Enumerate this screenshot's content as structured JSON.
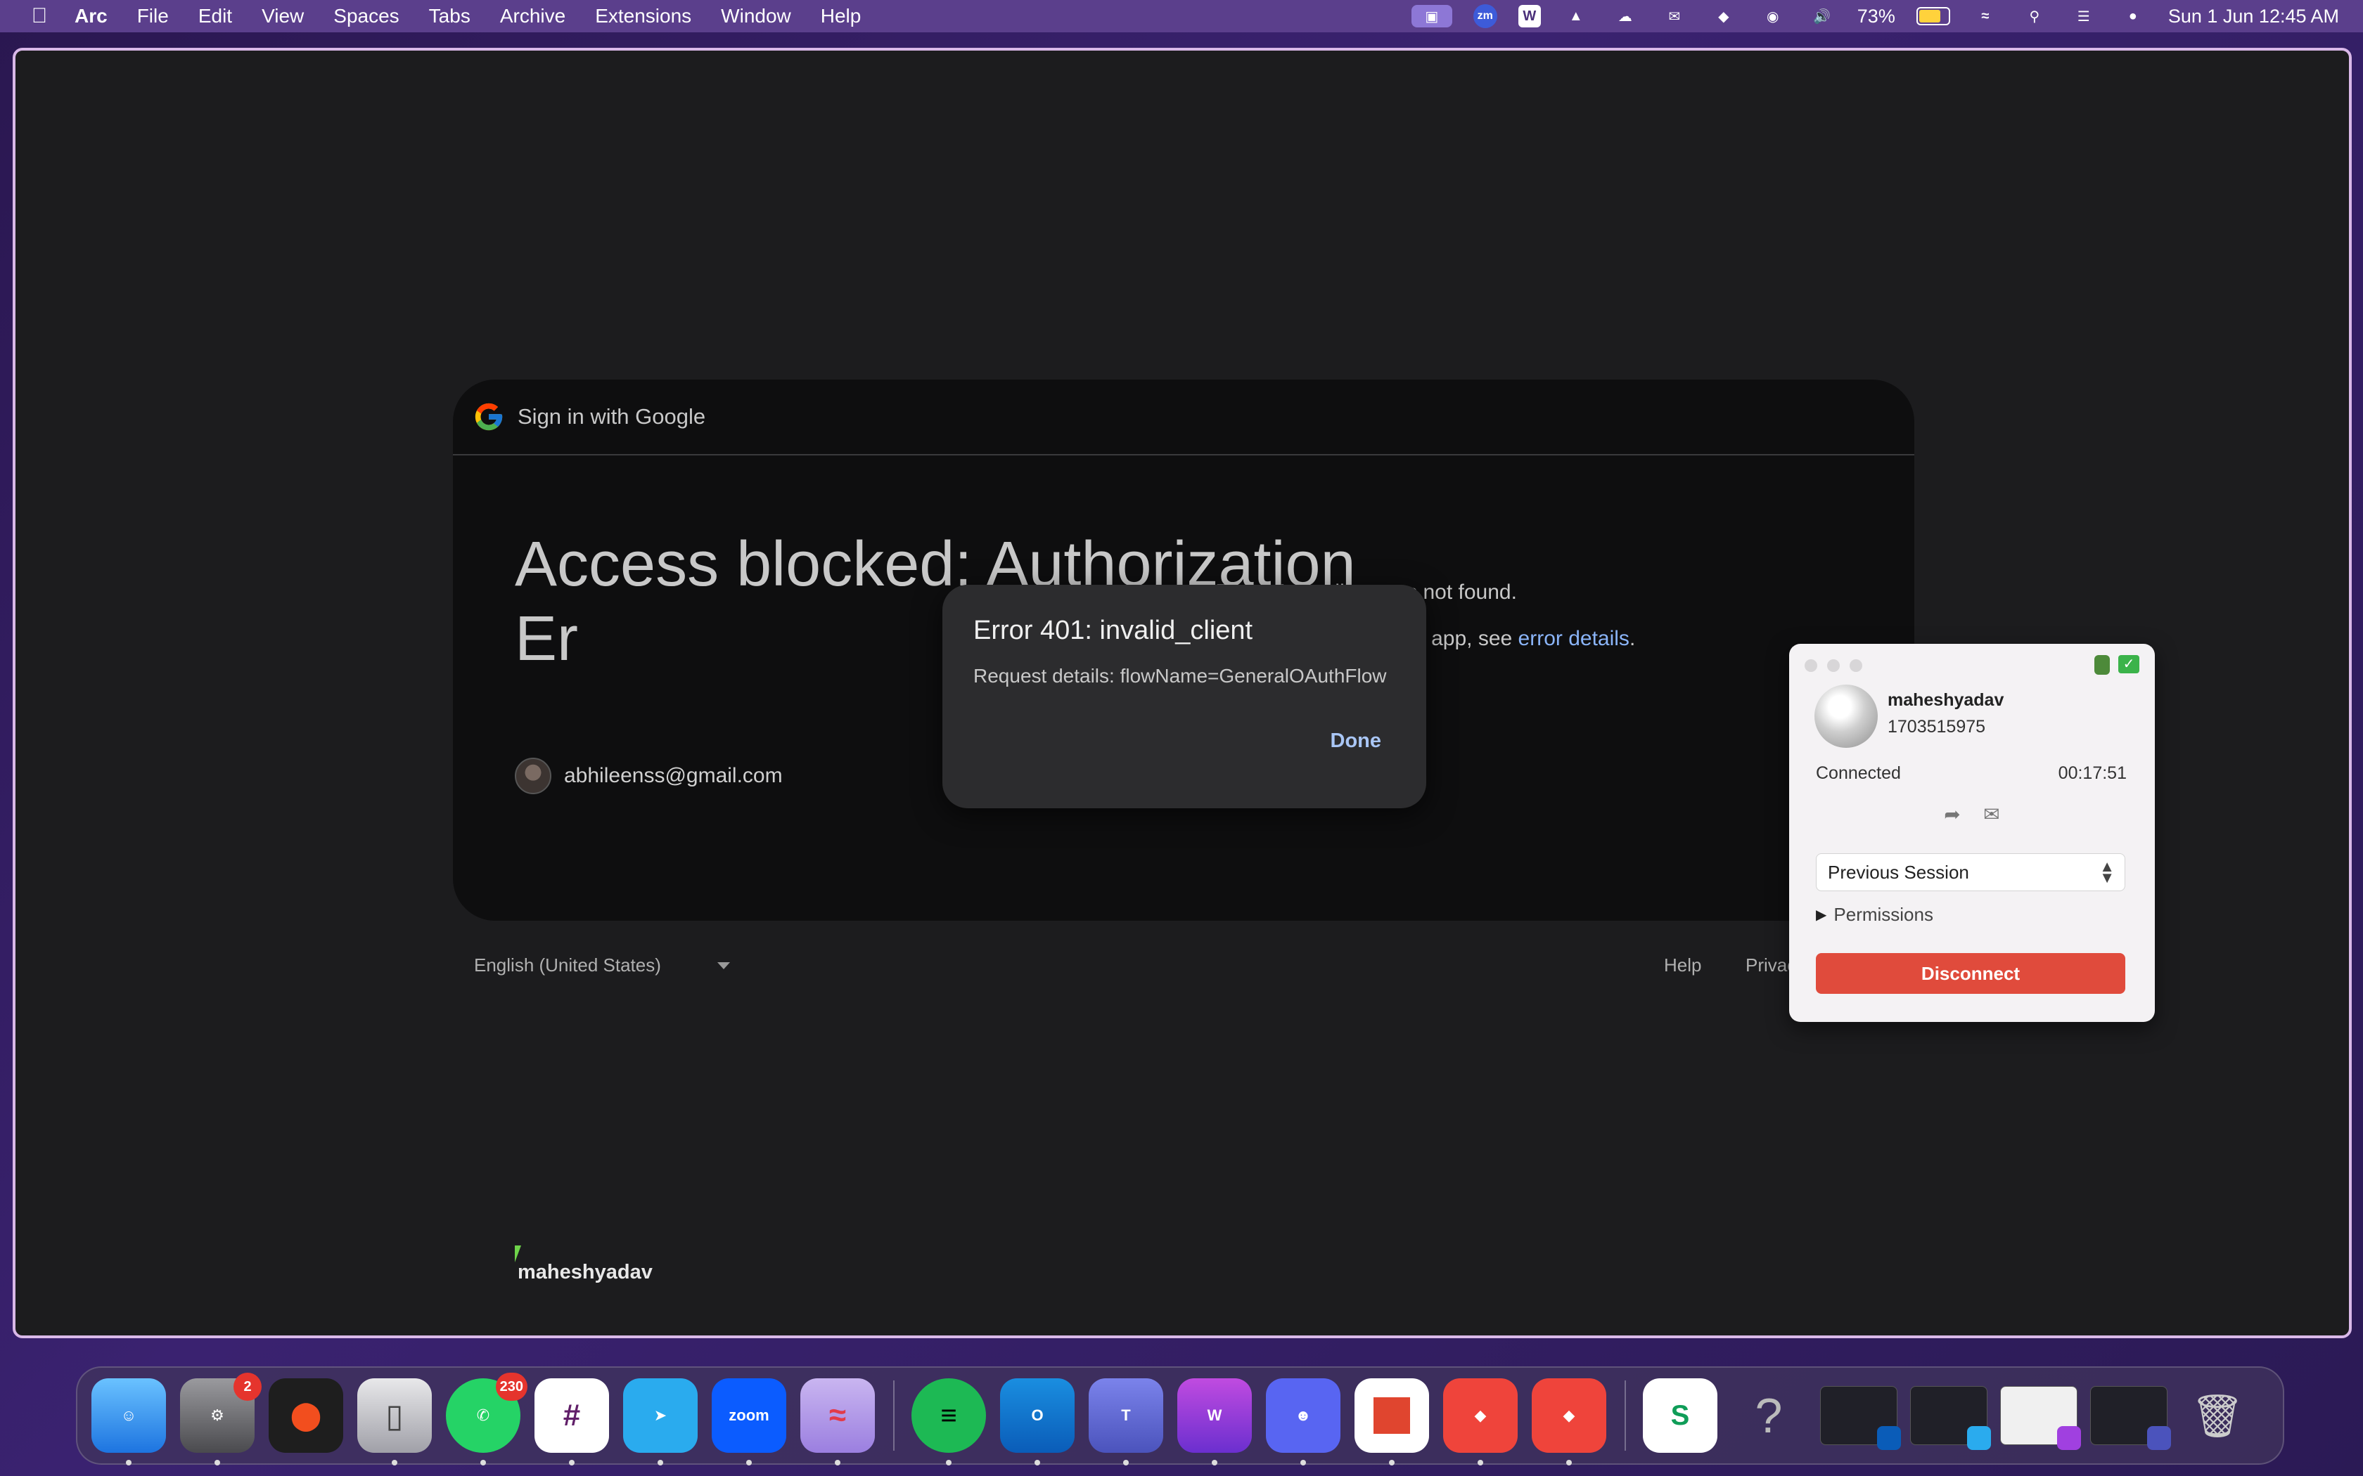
{
  "menubar": {
    "app_name": "Arc",
    "items": [
      "File",
      "Edit",
      "View",
      "Spaces",
      "Tabs",
      "Archive",
      "Extensions",
      "Window",
      "Help"
    ],
    "status": {
      "battery_percent": "73%",
      "datetime": "Sun 1 Jun  12:45 AM"
    }
  },
  "signin": {
    "header_label": "Sign in with Google",
    "headline": "Access blocked: Authorization Er",
    "email": "abhileenss@gmail.com",
    "oauth_message": "The OAuth client was not found.",
    "details_prefix": "of this app, see",
    "details_link": "error details",
    "details_suffix": "."
  },
  "footer": {
    "language": "English (United States)",
    "help": "Help",
    "privacy": "Privac"
  },
  "error_dialog": {
    "title": "Error 401: invalid_client",
    "details": "Request details: flowName=GeneralOAuthFlow",
    "done_label": "Done"
  },
  "remote_cursor_label": "maheshyadav",
  "anydesk": {
    "name": "maheshyadav",
    "id": "1703515975",
    "status": "Connected",
    "timer": "00:17:51",
    "session_select": "Previous Session",
    "permissions_label": "Permissions",
    "disconnect_label": "Disconnect"
  },
  "dock": {
    "badges": {
      "settings": "2",
      "whatsapp": "230"
    },
    "zoom_label": "zoom"
  },
  "colors": {
    "menubar": "#5b3f8c",
    "window_border": "#d9b8e8",
    "link": "#8ab4f8",
    "disconnect": "#e04b3c"
  }
}
